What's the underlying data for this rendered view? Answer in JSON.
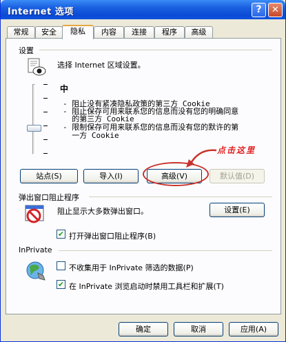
{
  "window": {
    "title": "Internet 选项",
    "help_glyph": "?",
    "close_glyph": "✕"
  },
  "tabs": [
    {
      "label": "常规",
      "active": false
    },
    {
      "label": "安全",
      "active": false
    },
    {
      "label": "隐私",
      "active": true
    },
    {
      "label": "内容",
      "active": false
    },
    {
      "label": "连接",
      "active": false
    },
    {
      "label": "程序",
      "active": false
    },
    {
      "label": "高级",
      "active": false
    }
  ],
  "settings": {
    "group_label": "设置",
    "select_text": "选择 Internet 区域设置。",
    "level": "中",
    "desc_lines": [
      "- 阻止没有紧凑隐私政策的第三方 Cookie",
      "- 阻止保存可用来联系您的信息而没有您的明确同意",
      "  的第三方 Cookie",
      "- 限制保存可用来联系您的信息而没有您的默许的第",
      "  一方 Cookie"
    ],
    "slider_level_fraction": 0.33,
    "buttons": {
      "sites": "站点(S)",
      "import": "导入(I)",
      "advanced": "高级(V)",
      "default": "默认值(D)"
    }
  },
  "annotation": {
    "text": "点击这里",
    "color": "#e02020"
  },
  "popup": {
    "group_label": "弹出窗口阻止程序",
    "desc": "阻止显示大多数弹出窗口。",
    "settings_button": "设置(E)",
    "checkbox_label": "打开弹出窗口阻止程序(B)",
    "checked": true
  },
  "inprivate": {
    "group_label": "InPrivate",
    "option1_label": "不收集用于 InPrivate 筛选的数据(P)",
    "option1_checked": false,
    "option2_label": "在 InPrivate 浏览启动时禁用工具栏和扩展(T)",
    "option2_checked": true
  },
  "footer": {
    "ok": "确定",
    "cancel": "取消",
    "apply": "应用(A)"
  },
  "colors": {
    "title_bar": "#0a4ad4",
    "dialog_bg": "#ece9d8",
    "panel_bg": "#fcfcfe",
    "annotation_red": "#c8322a"
  }
}
